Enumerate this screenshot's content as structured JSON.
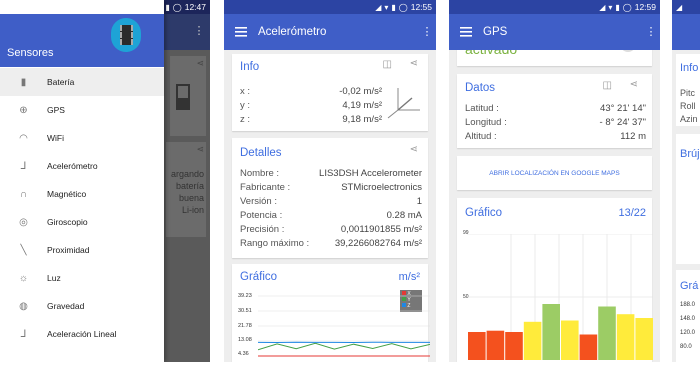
{
  "panel1": {
    "time": "12:47",
    "drawer_title": "Sensores",
    "items": [
      {
        "label": "Batería",
        "icon": "battery-icon"
      },
      {
        "label": "GPS",
        "icon": "gps-icon"
      },
      {
        "label": "WiFi",
        "icon": "wifi-icon"
      },
      {
        "label": "Acelerómetro",
        "icon": "axes-icon"
      },
      {
        "label": "Magnético",
        "icon": "magnet-icon"
      },
      {
        "label": "Giroscopio",
        "icon": "gyroscope-icon"
      },
      {
        "label": "Proximidad",
        "icon": "proximity-icon"
      },
      {
        "label": "Luz",
        "icon": "light-icon"
      },
      {
        "label": "Gravedad",
        "icon": "gravity-icon"
      },
      {
        "label": "Aceleración Lineal",
        "icon": "linear-acceleration-icon"
      }
    ],
    "behind_text": [
      "argando",
      "batería",
      "buena",
      "Li-ion"
    ]
  },
  "panel2": {
    "time": "12:55",
    "title": "Acelerómetro",
    "info": {
      "heading": "Info",
      "rows": [
        {
          "label": "x :",
          "value": "-0,02 m/s²"
        },
        {
          "label": "y :",
          "value": "4,19 m/s²"
        },
        {
          "label": "z :",
          "value": "9,18 m/s²"
        }
      ]
    },
    "details": {
      "heading": "Detalles",
      "rows": [
        {
          "label": "Nombre :",
          "value": "LIS3DSH Accelerometer"
        },
        {
          "label": "Fabricante :",
          "value": "STMicroelectronics"
        },
        {
          "label": "Versión :",
          "value": "1"
        },
        {
          "label": "Potencia :",
          "value": "0.28 mA"
        },
        {
          "label": "Precisión :",
          "value": "0,0011901855 m/s²"
        },
        {
          "label": "Rango máximo :",
          "value": "39,2266082764 m/s²"
        }
      ]
    },
    "graph": {
      "heading": "Gráfico",
      "unit": "m/s²",
      "ticks": [
        "39.23",
        "30.51",
        "21.78",
        "13.08",
        "4.36"
      ],
      "legend": [
        "X",
        "Y",
        "Z"
      ]
    }
  },
  "panel3": {
    "time": "12:59",
    "title": "GPS",
    "status": "activado",
    "data": {
      "heading": "Datos",
      "rows": [
        {
          "label": "Latitud :",
          "value": "43° 21' 14\""
        },
        {
          "label": "Longitud :",
          "value": "- 8° 24' 37\""
        },
        {
          "label": "Altitud :",
          "value": "112 m"
        }
      ]
    },
    "map_link": "ABRIR LOCALIZACIÓN EN GOOGLE MAPS",
    "graph": {
      "heading": "Gráfico",
      "count": "13/22",
      "ticks": [
        "99",
        "50"
      ]
    }
  },
  "panel4": {
    "info_heading": "Info",
    "rows": [
      "Pitc",
      "Roll",
      "Azin"
    ],
    "compass_heading": "Brúj",
    "graph_heading": "Grá",
    "ticks": [
      "188.0",
      "148.0",
      "120.0",
      "80.0"
    ]
  },
  "colors": {
    "primary": "#3f5ec7",
    "accent_text": "#3f6ee0",
    "green_status": "#7cb342"
  },
  "chart_data": [
    {
      "type": "line",
      "title": "Gráfico",
      "ylabel": "m/s²",
      "ylim": [
        4.36,
        39.23
      ],
      "series": [
        {
          "name": "X",
          "values": [
            0.0,
            0.1,
            -0.1,
            0.0,
            0.1,
            0.0,
            -0.1,
            0.0,
            0.1,
            0.0
          ]
        },
        {
          "name": "Y",
          "values": [
            4.4,
            8.2,
            5.1,
            8.6,
            4.8,
            8.0,
            5.2,
            8.4,
            5.0,
            7.9
          ]
        },
        {
          "name": "Z",
          "values": [
            9.2,
            9.1,
            9.3,
            9.2,
            9.2,
            9.1,
            9.3,
            9.2,
            9.2,
            9.2
          ]
        }
      ]
    },
    {
      "type": "bar",
      "title": "Gráfico",
      "ylim": [
        0,
        99
      ],
      "values": [
        22,
        23,
        22,
        30,
        44,
        31,
        20,
        42,
        36,
        33
      ],
      "colors": [
        "#f4511e",
        "#f4511e",
        "#f4511e",
        "#ffeb3b",
        "#9ccc65",
        "#ffeb3b",
        "#f4511e",
        "#9ccc65",
        "#ffeb3b",
        "#ffeb3b"
      ]
    }
  ]
}
